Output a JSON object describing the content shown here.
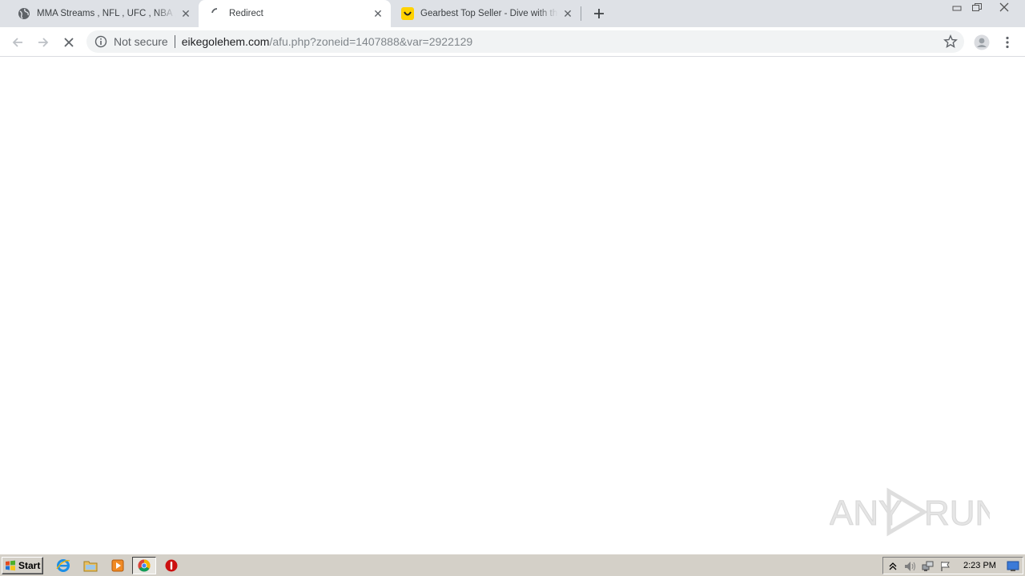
{
  "browser": {
    "tabs": [
      {
        "title": "MMA Streams , NFL , UFC , NBA , Boxing",
        "favicon": "globe-icon",
        "active": false
      },
      {
        "title": "Redirect",
        "favicon": "loading-spinner-icon",
        "active": true
      },
      {
        "title": "Gearbest Top Seller - Dive with the Gearbest",
        "favicon": "gearbest-smile-icon",
        "active": false
      }
    ],
    "new_tab_label": "+",
    "close_glyph": "✕"
  },
  "window_controls": {
    "minimize": "minimize-icon",
    "restore": "restore-icon",
    "close": "close-icon"
  },
  "toolbar": {
    "security_label": "Not secure",
    "url_host": "eikegolehem.com",
    "url_path": "/afu.php?zoneid=1407888&var=2922129"
  },
  "watermark": {
    "text_left": "ANY",
    "text_right": "RUN"
  },
  "taskbar": {
    "start_label": "Start",
    "clock": "2:23 PM",
    "icons": [
      "internet-explorer-icon",
      "file-explorer-icon",
      "media-player-icon",
      "chrome-icon",
      "stop-sign-icon"
    ]
  },
  "colors": {
    "tabstrip_bg": "#dee1e6",
    "omnibox_bg": "#f1f3f4",
    "taskbar_bg": "#d4d0c8",
    "gearbest_yellow": "#ffd200"
  }
}
